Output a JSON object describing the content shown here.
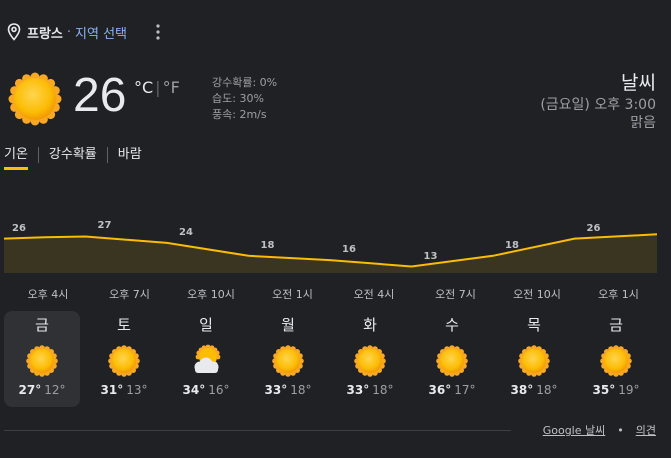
{
  "location": {
    "country": "프랑스",
    "separator": "·",
    "choose": "지역 선택"
  },
  "current": {
    "temp": "26",
    "unit_c": "°C",
    "unit_sep": "|",
    "unit_f": "°F",
    "precip": "강수확률: 0%",
    "humidity": "습도: 30%",
    "wind": "풍속: 2m/s",
    "icon": "sun-icon"
  },
  "header": {
    "title": "날씨",
    "time": "(금요일) 오후 3:00",
    "condition": "맑음"
  },
  "tabs": [
    {
      "label": "기온",
      "active": true
    },
    {
      "label": "강수확률",
      "active": false
    },
    {
      "label": "바람",
      "active": false
    }
  ],
  "chart_data": {
    "type": "area",
    "x": [
      "오후 4시",
      "오후 7시",
      "오후 10시",
      "오전 1시",
      "오전 4시",
      "오전 7시",
      "오전 10시",
      "오후 1시"
    ],
    "values": [
      26,
      27,
      24,
      18,
      16,
      13,
      18,
      26
    ],
    "labels": [
      "26",
      "27",
      "24",
      "18",
      "16",
      "13",
      "18",
      "26"
    ],
    "line_color": "#fbbc04",
    "fill_color": "#3a3520"
  },
  "days": [
    {
      "name": "금",
      "icon": "sun-icon",
      "hi": "27°",
      "lo": "12°",
      "selected": true
    },
    {
      "name": "토",
      "icon": "sun-icon",
      "hi": "31°",
      "lo": "13°",
      "selected": false
    },
    {
      "name": "일",
      "icon": "partly-cloudy-icon",
      "hi": "34°",
      "lo": "16°",
      "selected": false
    },
    {
      "name": "월",
      "icon": "sun-icon",
      "hi": "33°",
      "lo": "18°",
      "selected": false
    },
    {
      "name": "화",
      "icon": "sun-icon",
      "hi": "33°",
      "lo": "18°",
      "selected": false
    },
    {
      "name": "수",
      "icon": "sun-icon",
      "hi": "36°",
      "lo": "17°",
      "selected": false
    },
    {
      "name": "목",
      "icon": "sun-icon",
      "hi": "38°",
      "lo": "18°",
      "selected": false
    },
    {
      "name": "금",
      "icon": "sun-icon",
      "hi": "35°",
      "lo": "19°",
      "selected": false
    }
  ],
  "footer": {
    "source": "Google 날씨",
    "bullet": "•",
    "feedback": "의견"
  },
  "colors": {
    "accent": "#fbbc04",
    "link": "#8ab4f8",
    "background": "#202124"
  }
}
